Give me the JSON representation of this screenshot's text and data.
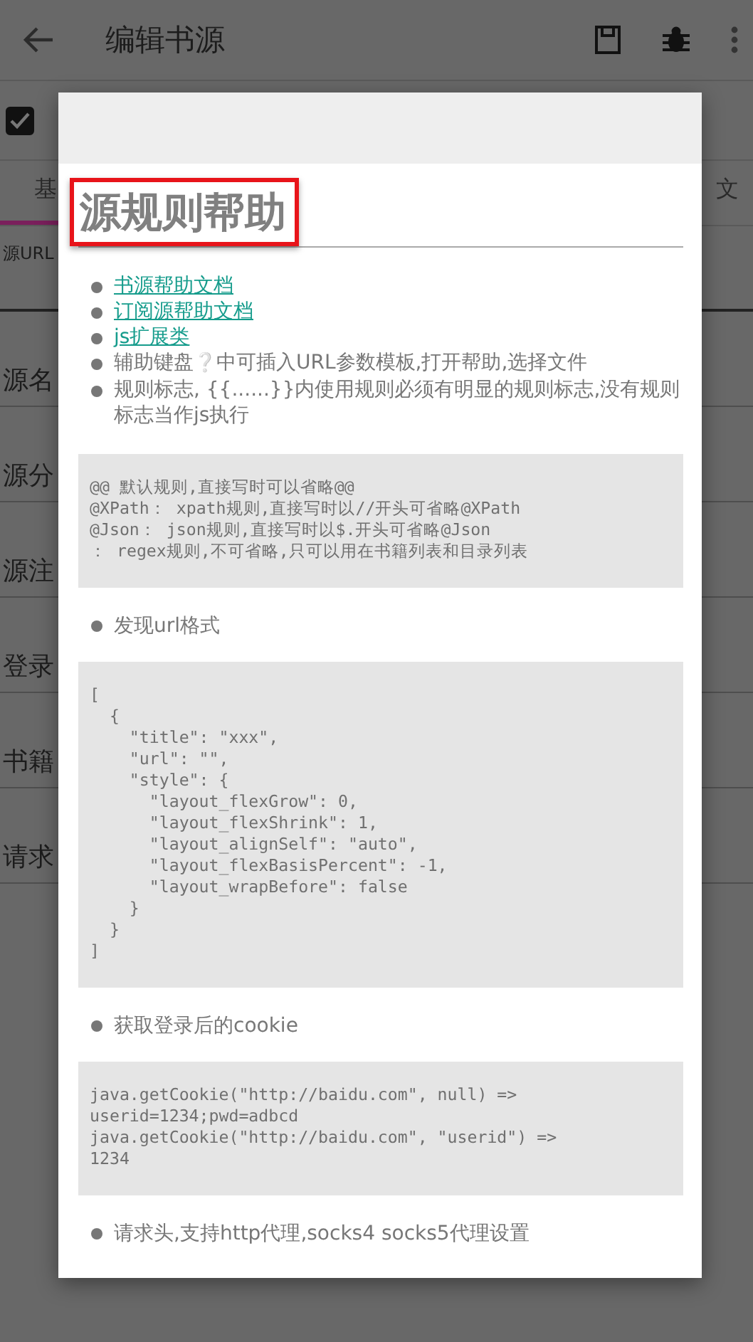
{
  "app_bar": {
    "title": "编辑书源"
  },
  "enable_row": {
    "checked": true
  },
  "tabs": [
    {
      "label": "基",
      "selected": true
    },
    {
      "label": "文",
      "selected": false
    }
  ],
  "url_field": {
    "label": "源URL"
  },
  "fields": [
    {
      "label": "源名"
    },
    {
      "label": "源分"
    },
    {
      "label": "源注"
    },
    {
      "label": "登录"
    },
    {
      "label": "书籍"
    },
    {
      "label": "请求"
    }
  ],
  "dialog": {
    "title": "源规则帮助",
    "highlighted": true,
    "sections": [
      {
        "kind": "list",
        "items": [
          {
            "kind": "link",
            "text": "书源帮助文档"
          },
          {
            "kind": "link",
            "text": "订阅源帮助文档"
          },
          {
            "kind": "link",
            "text": "js扩展类"
          },
          {
            "kind": "hint",
            "before": "辅助键盘",
            "mark": "❔",
            "after": "中可插入URL参数模板,打开帮助,选择文件"
          },
          {
            "kind": "text",
            "text": "规则标志, {{......}}内使用规则必须有明显的规则标志,没有规则标志当作js执行"
          }
        ]
      },
      {
        "kind": "code",
        "text": "@@ 默认规则,直接写时可以省略@@\n@XPath： xpath规则,直接写时以//开头可省略@XPath\n@Json： json规则,直接写时以$.开头可省略@Json\n： regex规则,不可省略,只可以用在书籍列表和目录列表"
      },
      {
        "kind": "bullet",
        "text": "发现url格式"
      },
      {
        "kind": "code",
        "text": "[\n  {\n    \"title\": \"xxx\",\n    \"url\": \"\",\n    \"style\": {\n      \"layout_flexGrow\": 0,\n      \"layout_flexShrink\": 1,\n      \"layout_alignSelf\": \"auto\",\n      \"layout_flexBasisPercent\": -1,\n      \"layout_wrapBefore\": false\n    }\n  }\n]"
      },
      {
        "kind": "bullet",
        "text": "获取登录后的cookie"
      },
      {
        "kind": "code",
        "text": "java.getCookie(\"http://baidu.com\", null) =>\nuserid=1234;pwd=adbcd\njava.getCookie(\"http://baidu.com\", \"userid\") =>\n1234"
      },
      {
        "kind": "bullet",
        "text": "请求头,支持http代理,socks4 socks5代理设置"
      }
    ]
  }
}
